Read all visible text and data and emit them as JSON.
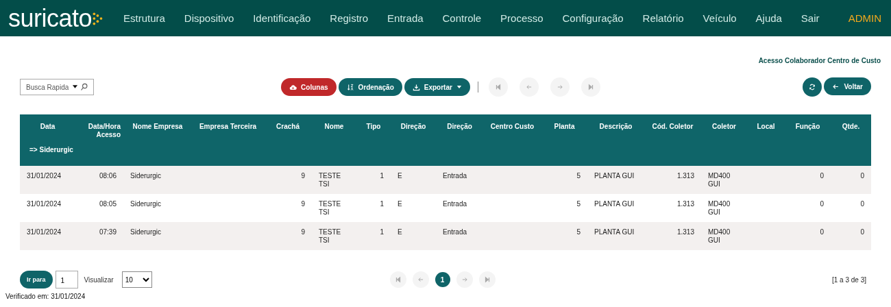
{
  "navbar": {
    "logo": "suricato",
    "items": [
      "Estrutura",
      "Dispositivo",
      "Identificação",
      "Registro",
      "Entrada",
      "Controle",
      "Processo",
      "Configuração",
      "Relatório",
      "Veículo",
      "Ajuda",
      "Sair"
    ],
    "user": "ADMIN"
  },
  "page_title": "Acesso Colaborador Centro de Custo",
  "quick_search": {
    "placeholder": "Busca Rapida"
  },
  "toolbar": {
    "buttons": [
      {
        "label": "Colunas",
        "kind": "columns"
      },
      {
        "label": "Ordenação",
        "kind": "sort"
      },
      {
        "label": "Exportar",
        "kind": "export"
      }
    ],
    "nav": [
      {
        "kind": "first",
        "disabled": true
      },
      {
        "kind": "prev",
        "disabled": true
      },
      {
        "kind": "next",
        "disabled": true
      },
      {
        "kind": "last",
        "disabled": true
      }
    ],
    "back_button": "Voltar"
  },
  "table": {
    "columns": [
      "Data",
      "Data/Hora Acesso",
      "Nome Empresa",
      "Empresa Terceira",
      "Crachá",
      "Nome",
      "Tipo",
      "Direção",
      "Direção",
      "Centro Custo",
      "Planta",
      "Descrição",
      "Cód. Coletor",
      "Coletor",
      "Local",
      "Função",
      "Qtde."
    ],
    "group": "=> Siderurgic",
    "rows": [
      [
        "31/01/2024",
        "08:06",
        "Siderurgic",
        "",
        "9",
        "TESTE TSI",
        "1",
        "E",
        "Entrada",
        "",
        "5",
        "PLANTA GUI",
        "1.313",
        "MD400 GUI",
        "",
        "0",
        "0"
      ],
      [
        "31/01/2024",
        "08:05",
        "Siderurgic",
        "",
        "9",
        "TESTE TSI",
        "1",
        "E",
        "Entrada",
        "",
        "5",
        "PLANTA GUI",
        "1.313",
        "MD400 GUI",
        "",
        "0",
        "0"
      ],
      [
        "31/01/2024",
        "07:39",
        "Siderurgic",
        "",
        "9",
        "TESTE TSI",
        "1",
        "E",
        "Entrada",
        "",
        "5",
        "PLANTA GUI",
        "1.313",
        "MD400 GUI",
        "",
        "0",
        "0"
      ]
    ]
  },
  "pager": {
    "goto_button": "Ir para",
    "page_input": "1",
    "view_label": "Visualizar",
    "page_size": "10",
    "nav_before": [
      {
        "kind": "first",
        "disabled": true
      },
      {
        "kind": "prev",
        "disabled": true
      }
    ],
    "pages": [
      {
        "label": "1",
        "selected": true
      }
    ],
    "nav_after": [
      {
        "kind": "next",
        "disabled": true
      },
      {
        "kind": "last",
        "disabled": true
      }
    ],
    "summary": "[1 a 3 de 3]"
  },
  "footer": "Verificado em: 31/01/2024"
}
